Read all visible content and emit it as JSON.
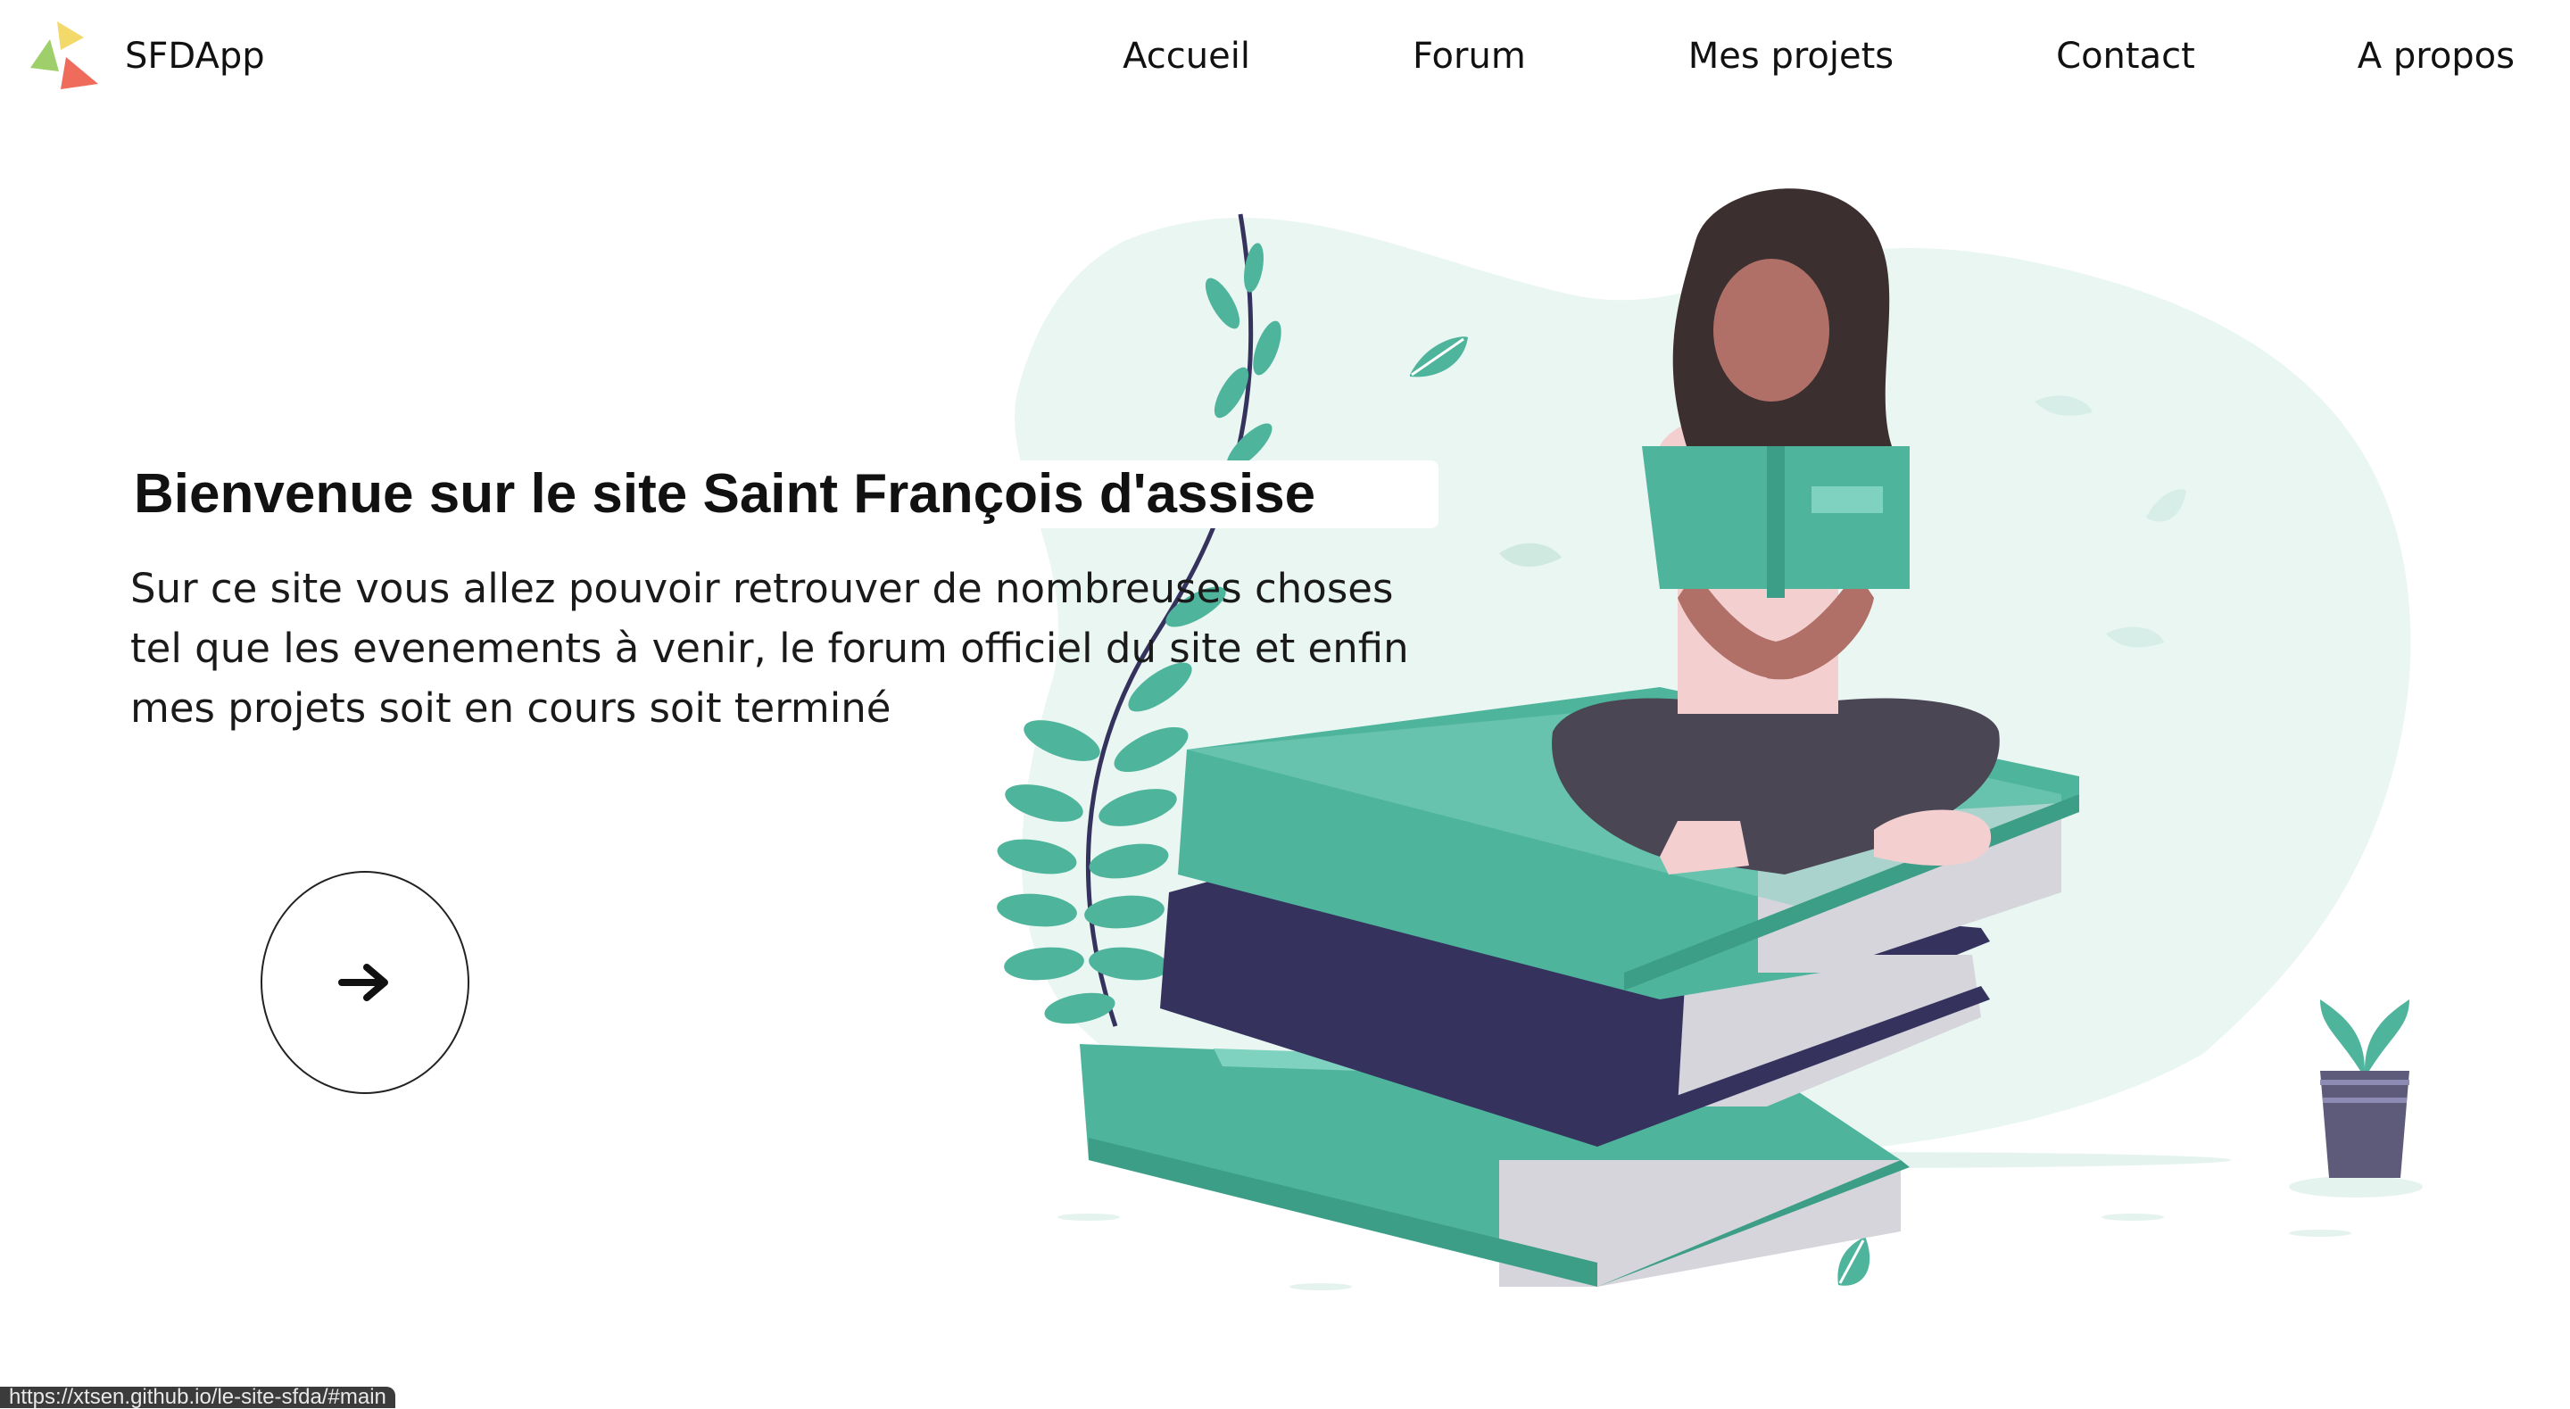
{
  "header": {
    "brand": "SFDApp",
    "nav": [
      "Accueil",
      "Forum",
      "Mes projets",
      "Contact",
      "A propos"
    ]
  },
  "hero": {
    "title": "Bienvenue sur le site Saint François d'assise",
    "text": "Sur ce site vous allez pouvoir retrouver de nombreuses choses tel que les evenements à venir, le forum officiel du site et enfin mes projets soit en cours soit terminé",
    "cta_icon": "arrow-right-icon"
  },
  "status_bar": {
    "url": "https://xtsen.github.io/le-site-sfda/#main"
  },
  "colors": {
    "teal": "#4fb49c",
    "teal_dark": "#3c9e87",
    "teal_light": "#e9f6f2",
    "navy": "#35325e",
    "skin": "#b07068",
    "hair": "#3b2f2f",
    "pants": "#4a4654"
  }
}
